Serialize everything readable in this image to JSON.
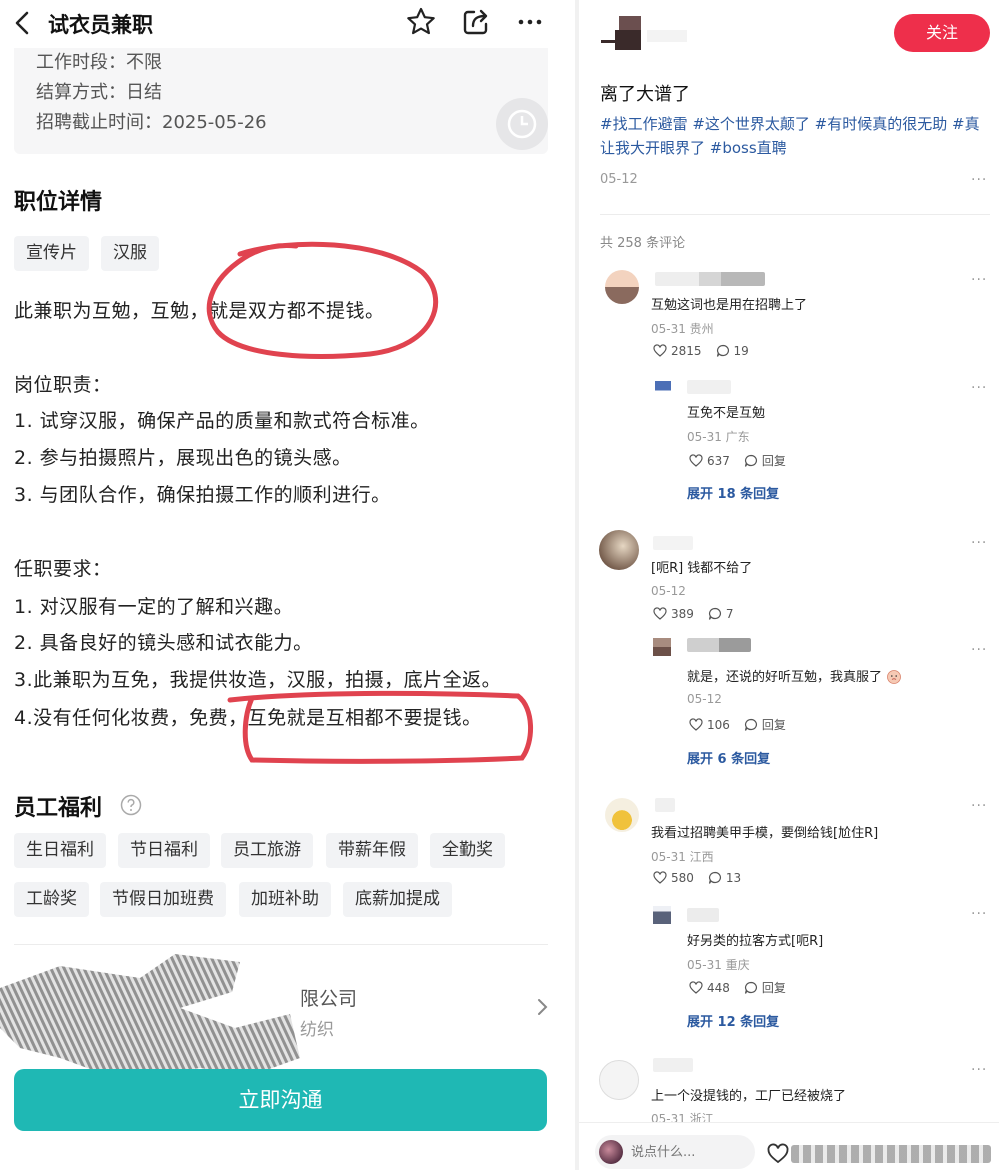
{
  "left": {
    "title": "试衣员兼职",
    "info": [
      {
        "label": "工作时段：",
        "value": "不限"
      },
      {
        "label": "结算方式：",
        "value": "日结"
      },
      {
        "label": "招聘截止时间：",
        "value": "2025-05-26"
      }
    ],
    "detail_heading": "职位详情",
    "detail_tags": [
      "宣传片",
      "汉服"
    ],
    "description": "此兼职为互勉，互勉，就是双方都不提钱。",
    "duties_heading": "岗位职责：",
    "duties": [
      "1. 试穿汉服，确保产品的质量和款式符合标准。",
      "2. 参与拍摄照片，展现出色的镜头感。",
      "3. 与团队合作，确保拍摄工作的顺利进行。"
    ],
    "requirements_heading": "任职要求：",
    "requirements": [
      "1. 对汉服有一定的了解和兴趣。",
      "2. 具备良好的镜头感和试衣能力。",
      "3.此兼职为互免，我提供妆造，汉服，拍摄，底片全返。",
      "4.没有任何化妆费，免费，互免就是互相都不要提钱。"
    ],
    "benefits_heading": "员工福利",
    "benefits_row1": [
      "生日福利",
      "节日福利",
      "员工旅游",
      "带薪年假",
      "全勤奖"
    ],
    "benefits_row2": [
      "工龄奖",
      "节假日加班费",
      "加班补助",
      "底薪加提成"
    ],
    "company_name_partial": "限公司",
    "company_sub_partial": "纺织",
    "cta": "立即沟通",
    "annotation_color": "#e0434f"
  },
  "right": {
    "follow": "关注",
    "post_title": "离了大谱了",
    "post_tags": "#找工作避雷 #这个世界太颠了 #有时候真的很无助 #真让我大开眼界了 #boss直聘",
    "post_date": "05-12",
    "comment_count": "共 258 条评论",
    "comments": [
      {
        "text": "互勉这词也是用在招聘上了",
        "meta": "05-31 贵州",
        "likes": "2815",
        "replies": "19"
      },
      {
        "text": "互免不是互勉",
        "meta": "05-31 广东",
        "likes": "637",
        "replies": "回复",
        "expand": "展开 18 条回复"
      },
      {
        "text": "[呃R] 钱都不给了",
        "meta": "05-12",
        "likes": "389",
        "replies": "7"
      },
      {
        "text": "就是，还说的好听互勉，我真服了",
        "meta": "05-12",
        "likes": "106",
        "replies": "回复",
        "expand": "展开 6 条回复"
      },
      {
        "text": "我看过招聘美甲手模，要倒给钱[尬住R]",
        "meta": "05-31 江西",
        "likes": "580",
        "replies": "13"
      },
      {
        "text": "好另类的拉客方式[呃R]",
        "meta": "05-31 重庆",
        "likes": "448",
        "replies": "回复",
        "expand": "展开 12 条回复"
      },
      {
        "text": "上一个没提钱的，工厂已经被烧了",
        "meta": "05-31 浙江"
      }
    ],
    "input_placeholder": "说点什么...",
    "accent": "#ee2f4b",
    "link_color": "#2c5aa0"
  }
}
